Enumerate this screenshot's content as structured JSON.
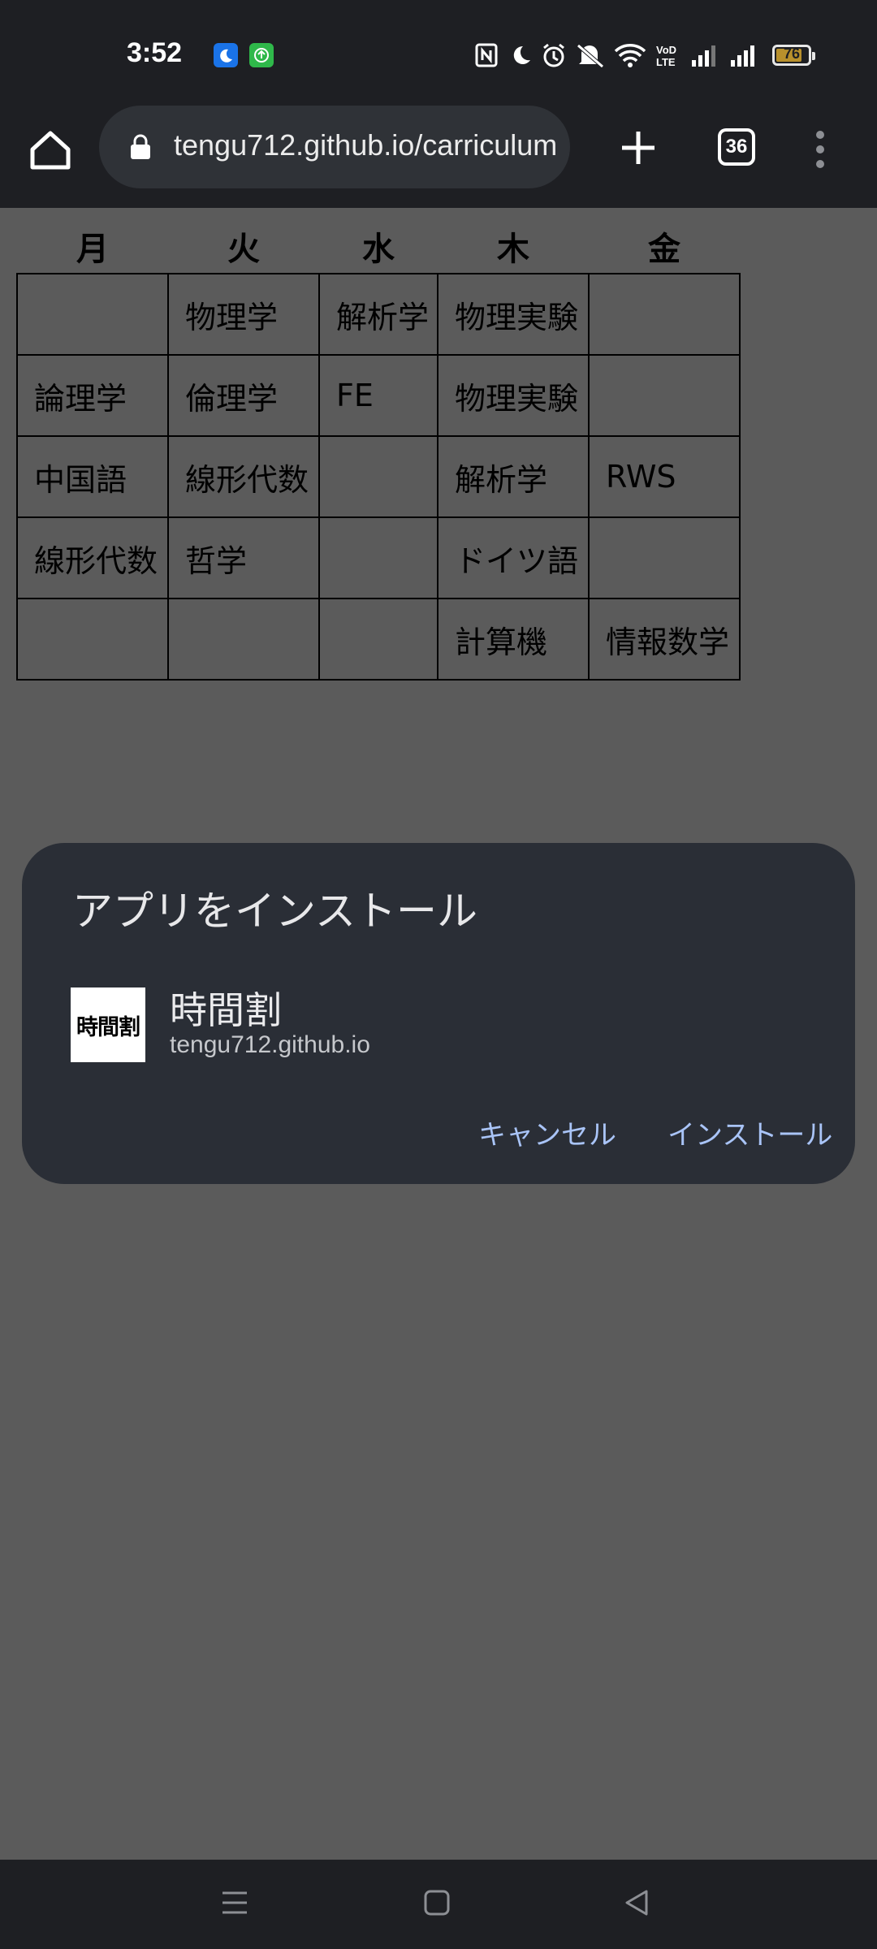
{
  "status_bar": {
    "time": "3:52",
    "battery_level": "76",
    "icons": [
      "moon-app-icon",
      "green-app-icon",
      "nfc-icon",
      "do-not-disturb-icon",
      "alarm-icon",
      "mute-icon",
      "wifi-icon",
      "volte-icon",
      "signal-icon",
      "signal-icon-2",
      "battery-icon"
    ]
  },
  "toolbar": {
    "url": "tengu712.github.io/carriculum",
    "tab_count": "36"
  },
  "timetable": {
    "headers": [
      "月",
      "火",
      "水",
      "木",
      "金"
    ],
    "rows": [
      [
        "",
        "物理学",
        "解析学",
        "物理実験",
        ""
      ],
      [
        "論理学",
        "倫理学",
        "FE",
        "物理実験",
        ""
      ],
      [
        "中国語",
        "線形代数",
        "",
        "解析学",
        "RWS"
      ],
      [
        "線形代数",
        "哲学",
        "",
        "ドイツ語",
        ""
      ],
      [
        "",
        "",
        "",
        "計算機",
        "情報数学"
      ]
    ]
  },
  "install_dialog": {
    "title": "アプリをインストール",
    "icon_text": "時間割",
    "app_name": "時間割",
    "app_domain": "tengu712.github.io",
    "cancel_label": "キャンセル",
    "install_label": "インストール"
  },
  "colors": {
    "scrim": "#5b5b5b",
    "chrome": "#1e1f23",
    "dialog": "#2a2e36",
    "accent": "#a9c4f7"
  }
}
